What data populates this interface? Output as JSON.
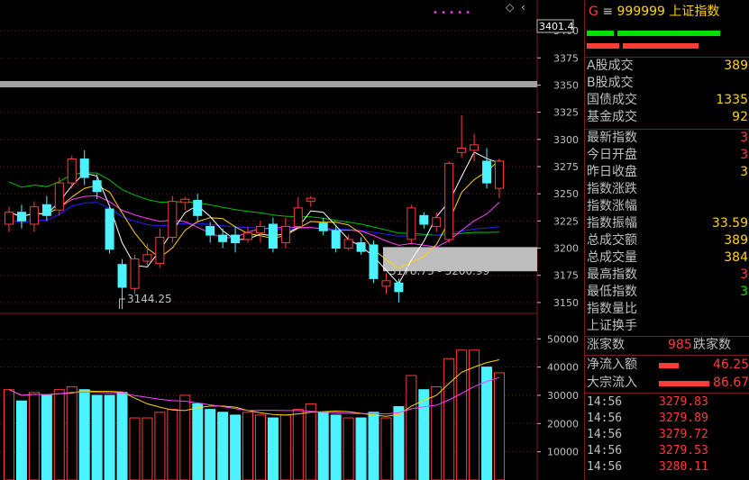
{
  "header": {
    "g_label": "G",
    "menu_icon": "≡",
    "code": "999999",
    "name": "上证指数",
    "price_tag": "3401.4"
  },
  "toolbar": {
    "dots": "• • • • •",
    "diamond_icon": "◇"
  },
  "main_axis": {
    "ticks": [
      "3400",
      "3375",
      "3350",
      "3325",
      "3300",
      "3275",
      "3250",
      "3225",
      "3200",
      "3175",
      "3150"
    ]
  },
  "vol_axis": {
    "ticks": [
      "50000",
      "40000",
      "30000",
      "20000",
      "10000"
    ]
  },
  "annotations": {
    "low_label": "3144.25",
    "zone_label": "3178.73 - 3200.99"
  },
  "colors": {
    "up": "#ff3b3b",
    "down": "#4cf2ff",
    "ma5": "#ffffff",
    "ma10": "#ffd400",
    "ma20": "#ff40ff",
    "ma60": "#00c000",
    "ma120": "#2020ff"
  },
  "chart_data": {
    "type": "candlestick",
    "ylim": [
      3140,
      3410
    ],
    "candles": [
      {
        "o": 3222,
        "c": 3233,
        "h": 3238,
        "l": 3215,
        "v": 32000
      },
      {
        "o": 3233,
        "c": 3225,
        "h": 3240,
        "l": 3218,
        "v": 28000
      },
      {
        "o": 3222,
        "c": 3238,
        "h": 3243,
        "l": 3215,
        "v": 31000
      },
      {
        "o": 3240,
        "c": 3230,
        "h": 3248,
        "l": 3225,
        "v": 30000
      },
      {
        "o": 3235,
        "c": 3260,
        "h": 3265,
        "l": 3230,
        "v": 32000
      },
      {
        "o": 3260,
        "c": 3282,
        "h": 3285,
        "l": 3255,
        "v": 33000
      },
      {
        "o": 3282,
        "c": 3265,
        "h": 3290,
        "l": 3258,
        "v": 32000
      },
      {
        "o": 3262,
        "c": 3252,
        "h": 3268,
        "l": 3245,
        "v": 30000
      },
      {
        "o": 3236,
        "c": 3199,
        "h": 3240,
        "l": 3195,
        "v": 30000
      },
      {
        "o": 3185,
        "c": 3164,
        "h": 3190,
        "l": 3144,
        "v": 31000
      },
      {
        "o": 3163,
        "c": 3190,
        "h": 3194,
        "l": 3158,
        "v": 22000
      },
      {
        "o": 3188,
        "c": 3194,
        "h": 3204,
        "l": 3183,
        "v": 22000
      },
      {
        "o": 3186,
        "c": 3210,
        "h": 3218,
        "l": 3182,
        "v": 24000
      },
      {
        "o": 3210,
        "c": 3243,
        "h": 3248,
        "l": 3205,
        "v": 25000
      },
      {
        "o": 3242,
        "c": 3245,
        "h": 3247,
        "l": 3235,
        "v": 30000
      },
      {
        "o": 3244,
        "c": 3230,
        "h": 3250,
        "l": 3225,
        "v": 27000
      },
      {
        "o": 3220,
        "c": 3212,
        "h": 3224,
        "l": 3205,
        "v": 25000
      },
      {
        "o": 3212,
        "c": 3206,
        "h": 3218,
        "l": 3200,
        "v": 24000
      },
      {
        "o": 3212,
        "c": 3205,
        "h": 3220,
        "l": 3196,
        "v": 23000
      },
      {
        "o": 3208,
        "c": 3214,
        "h": 3220,
        "l": 3205,
        "v": 24000
      },
      {
        "o": 3214,
        "c": 3220,
        "h": 3225,
        "l": 3205,
        "v": 23000
      },
      {
        "o": 3222,
        "c": 3200,
        "h": 3228,
        "l": 3196,
        "v": 22000
      },
      {
        "o": 3205,
        "c": 3220,
        "h": 3228,
        "l": 3200,
        "v": 23000
      },
      {
        "o": 3220,
        "c": 3237,
        "h": 3247,
        "l": 3218,
        "v": 25000
      },
      {
        "o": 3243,
        "c": 3246,
        "h": 3248,
        "l": 3238,
        "v": 27000
      },
      {
        "o": 3223,
        "c": 3216,
        "h": 3228,
        "l": 3212,
        "v": 24000
      },
      {
        "o": 3216,
        "c": 3200,
        "h": 3220,
        "l": 3196,
        "v": 23000
      },
      {
        "o": 3200,
        "c": 3208,
        "h": 3212,
        "l": 3198,
        "v": 22000
      },
      {
        "o": 3205,
        "c": 3197,
        "h": 3210,
        "l": 3194,
        "v": 22000
      },
      {
        "o": 3203,
        "c": 3172,
        "h": 3207,
        "l": 3168,
        "v": 24000
      },
      {
        "o": 3165,
        "c": 3170,
        "h": 3177,
        "l": 3158,
        "v": 22000
      },
      {
        "o": 3168,
        "c": 3160,
        "h": 3172,
        "l": 3150,
        "v": 26000
      },
      {
        "o": 3208,
        "c": 3237,
        "h": 3240,
        "l": 3204,
        "v": 37000
      },
      {
        "o": 3230,
        "c": 3222,
        "h": 3233,
        "l": 3218,
        "v": 32000
      },
      {
        "o": 3220,
        "c": 3228,
        "h": 3233,
        "l": 3215,
        "v": 33000
      },
      {
        "o": 3208,
        "c": 3278,
        "h": 3280,
        "l": 3205,
        "v": 43000
      },
      {
        "o": 3288,
        "c": 3292,
        "h": 3322,
        "l": 3283,
        "v": 46000
      },
      {
        "o": 3290,
        "c": 3295,
        "h": 3305,
        "l": 3280,
        "v": 46000
      },
      {
        "o": 3280,
        "c": 3260,
        "h": 3292,
        "l": 3255,
        "v": 40000
      },
      {
        "o": 3255,
        "c": 3280,
        "h": 3282,
        "l": 3246,
        "v": 38000
      }
    ],
    "vol_ylim": [
      0,
      52000
    ],
    "zone": {
      "low": 3178.73,
      "high": 3200.99
    }
  },
  "panel": {
    "rows1": [
      {
        "label": "A股成交",
        "value": "389",
        "cls": ""
      },
      {
        "label": "B股成交",
        "value": "",
        "cls": ""
      },
      {
        "label": "国债成交",
        "value": "1335",
        "cls": ""
      },
      {
        "label": "基金成交",
        "value": "92",
        "cls": ""
      }
    ],
    "rows2": [
      {
        "label": "最新指数",
        "value": "3",
        "cls": "red"
      },
      {
        "label": "今日开盘",
        "value": "3",
        "cls": "red"
      },
      {
        "label": "昨日收盘",
        "value": "3",
        "cls": ""
      },
      {
        "label": "指数涨跌",
        "value": "",
        "cls": ""
      },
      {
        "label": "指数涨幅",
        "value": "",
        "cls": ""
      },
      {
        "label": "指数振幅",
        "value": "33.59",
        "cls": ""
      },
      {
        "label": "总成交额",
        "value": "389",
        "cls": ""
      },
      {
        "label": "总成交量",
        "value": "384",
        "cls": ""
      },
      {
        "label": "最高指数",
        "value": "3",
        "cls": "red"
      },
      {
        "label": "最低指数",
        "value": "3",
        "cls": "grn"
      },
      {
        "label": "指数量比",
        "value": "",
        "cls": ""
      },
      {
        "label": "上证换手",
        "value": "",
        "cls": ""
      }
    ],
    "advance": {
      "label": "涨家数",
      "value": "985",
      "label2": "跌家数"
    },
    "flows": [
      {
        "label": "净流入额",
        "value": "46.25亿"
      },
      {
        "label": "大宗流入",
        "value": "86.67亿"
      }
    ],
    "ticks": [
      {
        "time": "14:56",
        "price": "3279.83"
      },
      {
        "time": "14:56",
        "price": "3279.89"
      },
      {
        "time": "14:56",
        "price": "3279.72"
      },
      {
        "time": "14:56",
        "price": "3279.53"
      },
      {
        "time": "14:56",
        "price": "3280.11"
      }
    ]
  }
}
